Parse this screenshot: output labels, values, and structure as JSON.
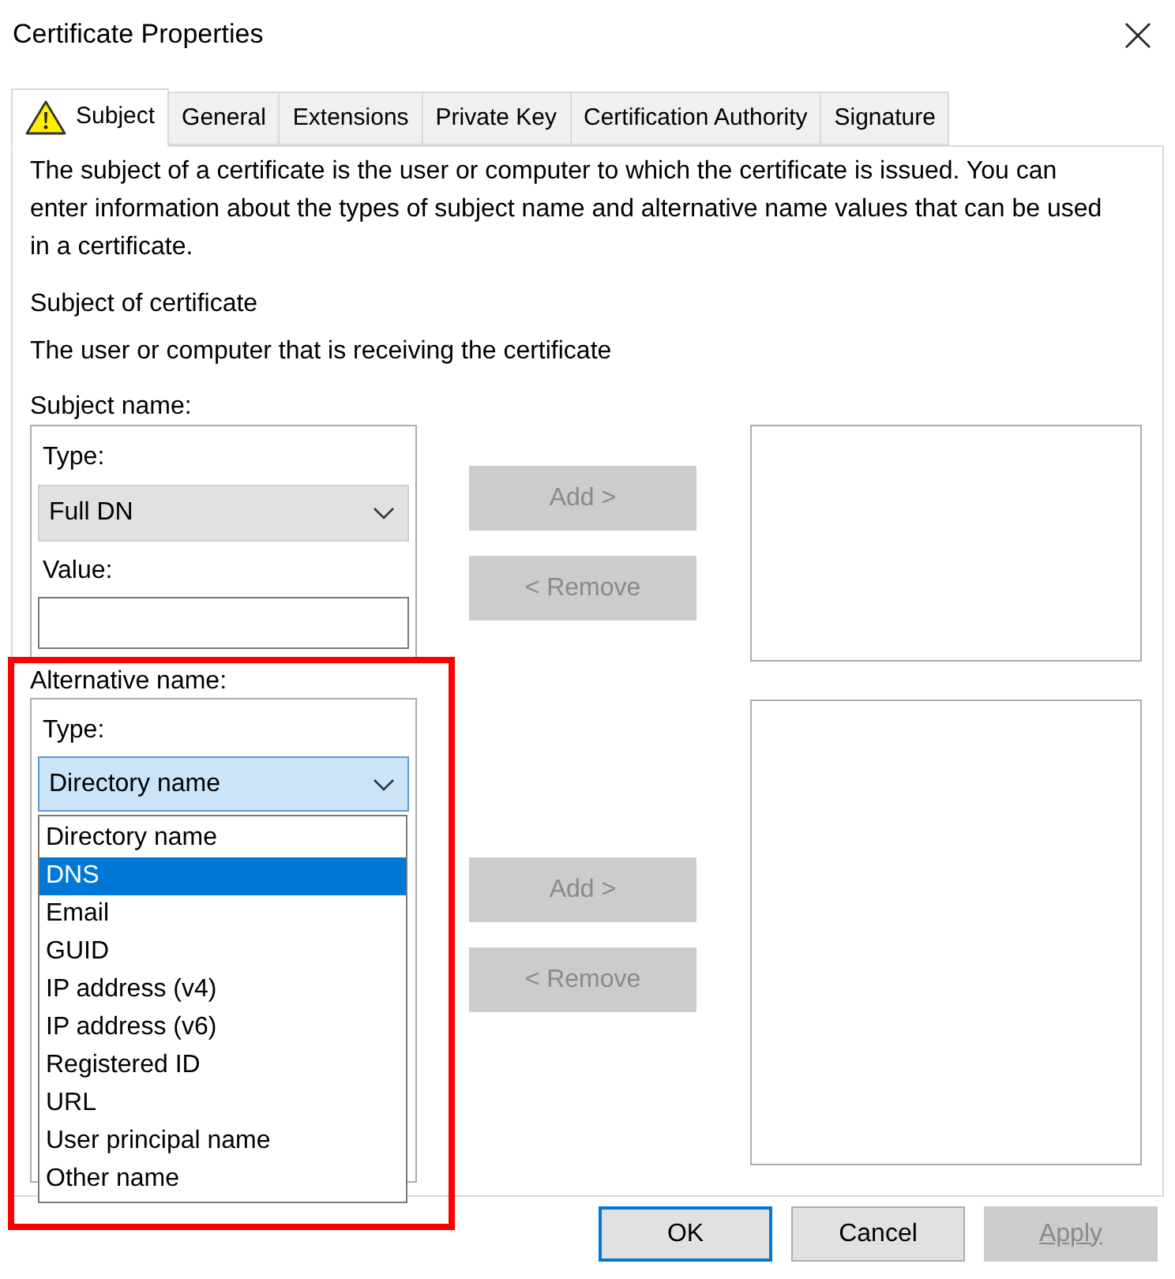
{
  "window": {
    "title": "Certificate Properties"
  },
  "tabs": [
    {
      "label": "Subject",
      "selected": true,
      "kind": "warning"
    },
    {
      "label": "General",
      "selected": false,
      "kind": "plain"
    },
    {
      "label": "Extensions",
      "selected": false,
      "kind": "plain"
    },
    {
      "label": "Private Key",
      "selected": false,
      "kind": "plain"
    },
    {
      "label": "Certification Authority",
      "selected": false,
      "kind": "plain"
    },
    {
      "label": "Signature",
      "selected": false,
      "kind": "plain"
    }
  ],
  "description": "The subject of a certificate is the user or computer to which the certificate is issued. You can enter information about the types of subject name and alternative name values that can be used in a certificate.",
  "section_title": "Subject of certificate",
  "section_subtitle": "The user or computer that is receiving the certificate",
  "subject_name": {
    "label": "Subject name:",
    "type_label": "Type:",
    "type_value": "Full DN",
    "expanded": false,
    "value_label": "Value:",
    "add_button": {
      "label": "Add >",
      "disabled": true
    },
    "remove_button": {
      "label": "< Remove",
      "disabled": true
    }
  },
  "alternative_name": {
    "label": "Alternative name:",
    "type_label": "Type:",
    "type_value": "Directory name",
    "expanded": true,
    "options": [
      {
        "label": "Directory name",
        "selected": false
      },
      {
        "label": "DNS",
        "selected": true
      },
      {
        "label": "Email",
        "selected": false
      },
      {
        "label": "GUID",
        "selected": false
      },
      {
        "label": "IP address (v4)",
        "selected": false
      },
      {
        "label": "IP address (v6)",
        "selected": false
      },
      {
        "label": "Registered ID",
        "selected": false
      },
      {
        "label": "URL",
        "selected": false
      },
      {
        "label": "User principal name",
        "selected": false
      },
      {
        "label": "Other name",
        "selected": false
      }
    ],
    "add_button": {
      "label": "Add >",
      "disabled": true
    },
    "remove_button": {
      "label": "< Remove",
      "disabled": true
    }
  },
  "buttons": [
    {
      "label": "OK",
      "default": true,
      "disabled": false
    },
    {
      "label": "Cancel",
      "default": false,
      "disabled": false
    },
    {
      "label": "Apply",
      "default": false,
      "disabled": true
    }
  ]
}
